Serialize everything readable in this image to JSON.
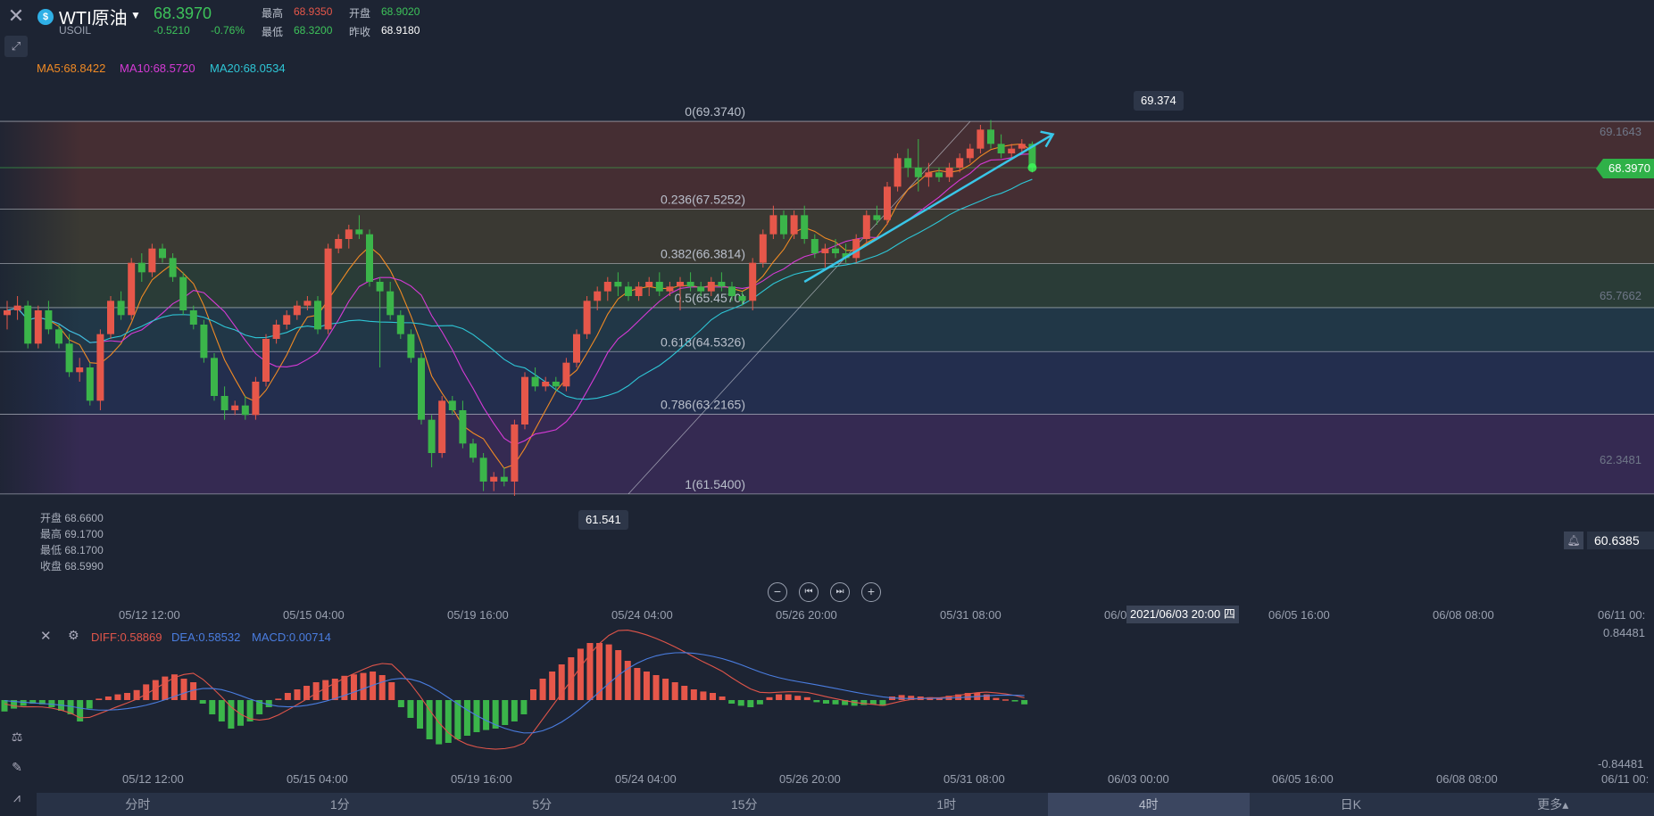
{
  "header": {
    "symbol_name": "WTI原油",
    "symbol_code": "USOIL",
    "last_price": "68.3970",
    "change": "-0.5210",
    "change_pct": "-0.76%",
    "quote_labels": {
      "high": "最高",
      "low": "最低",
      "open": "开盘",
      "prev_close": "昨收"
    },
    "quote_values": {
      "high": "68.9350",
      "low": "68.3200",
      "open": "68.9020",
      "prev_close": "68.9180"
    }
  },
  "ma_legend": [
    {
      "label": "MA5:68.8422",
      "color": "#f08a24"
    },
    {
      "label": "MA10:68.5720",
      "color": "#d63ad6"
    },
    {
      "label": "MA20:68.0534",
      "color": "#2ec6d6"
    }
  ],
  "fib_levels": [
    {
      "ratio": 0,
      "label": "0(69.3740)",
      "price": 69.374
    },
    {
      "ratio": 0.236,
      "label": "0.236(67.5252)",
      "price": 67.5252
    },
    {
      "ratio": 0.382,
      "label": "0.382(66.3814)",
      "price": 66.3814
    },
    {
      "ratio": 0.5,
      "label": "0.5(65.4570)",
      "price": 65.457
    },
    {
      "ratio": 0.618,
      "label": "0.618(64.5326)",
      "price": 64.5326
    },
    {
      "ratio": 0.786,
      "label": "0.786(63.2165)",
      "price": 63.2165
    },
    {
      "ratio": 1,
      "label": "1(61.5400)",
      "price": 61.54
    }
  ],
  "price_axis": [
    "69.1643",
    "65.7662",
    "62.3481"
  ],
  "current_price_tag": "68.3970",
  "high_marker": "69.374",
  "low_marker": "61.541",
  "alert_price": "60.6385",
  "ohlc": [
    {
      "label": "开盘",
      "value": "68.6600"
    },
    {
      "label": "最高",
      "value": "69.1700"
    },
    {
      "label": "最低",
      "value": "68.1700"
    },
    {
      "label": "收盘",
      "value": "68.5990"
    }
  ],
  "x_axis_main": [
    "05/12 12:00",
    "05/15 04:00",
    "05/19 16:00",
    "05/24 04:00",
    "05/26 20:00",
    "05/31 08:00",
    "06/0",
    "06/05 16:00",
    "06/08 08:00",
    "06/11 00:"
  ],
  "crosshair_time": "2021/06/03 20:00 四",
  "x_axis_macd": [
    "05/12 12:00",
    "05/15 04:00",
    "05/19 16:00",
    "05/24 04:00",
    "05/26 20:00",
    "05/31 08:00",
    "06/03 00:00",
    "06/05 16:00",
    "06/08 08:00",
    "06/11 00:"
  ],
  "macd_legend": [
    {
      "label": "DIFF:0.58869",
      "color": "#e0554a"
    },
    {
      "label": "DEA:0.58532",
      "color": "#4a7de0"
    },
    {
      "label": "MACD:0.00714",
      "color": "#4a7de0"
    }
  ],
  "macd_axis": [
    "0.84481",
    "-0.84481"
  ],
  "timeframes": [
    {
      "label": "分时",
      "active": false
    },
    {
      "label": "1分",
      "active": false
    },
    {
      "label": "5分",
      "active": false
    },
    {
      "label": "15分",
      "active": false
    },
    {
      "label": "1时",
      "active": false
    },
    {
      "label": "4时",
      "active": true
    },
    {
      "label": "日K",
      "active": false
    },
    {
      "label": "更多▴",
      "active": false
    }
  ],
  "colors": {
    "up": "#e6574a",
    "down": "#3bb54a",
    "background": "#1d2433"
  },
  "icons": [
    "close-icon",
    "expand-icon",
    "symbol-icon",
    "zoom-out-icon",
    "step-back-icon",
    "step-forward-icon",
    "zoom-in-icon",
    "bell-icon",
    "indicator-icon",
    "pen-icon",
    "chart-type-icon",
    "settings-icon"
  ],
  "chart_data": {
    "type": "candlestick",
    "ylim": [
      60.3,
      70.8
    ],
    "candles": [
      [
        65.3,
        65.6,
        65.0,
        65.4
      ],
      [
        65.4,
        65.7,
        65.2,
        65.5
      ],
      [
        65.5,
        65.6,
        64.6,
        64.7
      ],
      [
        64.7,
        65.5,
        64.6,
        65.4
      ],
      [
        65.4,
        65.6,
        64.9,
        65.0
      ],
      [
        65.0,
        65.1,
        64.6,
        64.7
      ],
      [
        64.7,
        64.9,
        64.0,
        64.1
      ],
      [
        64.1,
        64.4,
        63.9,
        64.2
      ],
      [
        64.2,
        64.3,
        63.4,
        63.5
      ],
      [
        63.5,
        65.0,
        63.3,
        64.9
      ],
      [
        64.9,
        65.7,
        64.8,
        65.6
      ],
      [
        65.6,
        65.8,
        65.2,
        65.3
      ],
      [
        65.3,
        66.5,
        65.2,
        66.4
      ],
      [
        66.4,
        66.6,
        66.0,
        66.2
      ],
      [
        66.2,
        66.8,
        66.1,
        66.7
      ],
      [
        66.7,
        66.8,
        66.4,
        66.5
      ],
      [
        66.5,
        66.6,
        66.0,
        66.1
      ],
      [
        66.1,
        66.2,
        65.3,
        65.4
      ],
      [
        65.4,
        65.5,
        65.0,
        65.1
      ],
      [
        65.1,
        65.2,
        64.3,
        64.4
      ],
      [
        64.4,
        64.5,
        63.5,
        63.6
      ],
      [
        63.6,
        63.8,
        63.1,
        63.3
      ],
      [
        63.3,
        63.5,
        63.2,
        63.4
      ],
      [
        63.4,
        63.6,
        63.1,
        63.2
      ],
      [
        63.2,
        64.0,
        63.1,
        63.9
      ],
      [
        63.9,
        64.9,
        63.8,
        64.8
      ],
      [
        64.8,
        65.2,
        64.7,
        65.1
      ],
      [
        65.1,
        65.4,
        65.0,
        65.3
      ],
      [
        65.3,
        65.6,
        65.2,
        65.5
      ],
      [
        65.5,
        65.7,
        65.4,
        65.6
      ],
      [
        65.6,
        65.7,
        64.9,
        65.0
      ],
      [
        65.0,
        66.8,
        64.9,
        66.7
      ],
      [
        66.7,
        67.0,
        66.6,
        66.9
      ],
      [
        66.9,
        67.2,
        66.7,
        67.1
      ],
      [
        67.1,
        67.4,
        66.9,
        67.0
      ],
      [
        67.0,
        67.1,
        65.9,
        66.0
      ],
      [
        66.0,
        66.1,
        64.2,
        65.8
      ],
      [
        65.8,
        66.0,
        65.2,
        65.3
      ],
      [
        65.3,
        65.4,
        64.8,
        64.9
      ],
      [
        64.9,
        65.0,
        64.3,
        64.4
      ],
      [
        64.4,
        64.5,
        63.0,
        63.1
      ],
      [
        63.1,
        63.2,
        62.1,
        62.4
      ],
      [
        62.4,
        63.6,
        62.3,
        63.5
      ],
      [
        63.5,
        63.6,
        63.2,
        63.3
      ],
      [
        63.3,
        63.5,
        62.5,
        62.6
      ],
      [
        62.6,
        62.7,
        62.2,
        62.3
      ],
      [
        62.3,
        62.4,
        61.6,
        61.8
      ],
      [
        61.8,
        62.0,
        61.6,
        61.9
      ],
      [
        61.9,
        62.1,
        61.7,
        61.8
      ],
      [
        61.8,
        63.1,
        61.5,
        63.0
      ],
      [
        63.0,
        64.1,
        62.9,
        64.0
      ],
      [
        64.0,
        64.2,
        63.7,
        63.8
      ],
      [
        63.8,
        64.0,
        63.7,
        63.9
      ],
      [
        63.9,
        64.0,
        63.7,
        63.8
      ],
      [
        63.8,
        64.4,
        63.7,
        64.3
      ],
      [
        64.3,
        65.0,
        64.2,
        64.9
      ],
      [
        64.9,
        65.7,
        64.8,
        65.6
      ],
      [
        65.6,
        65.9,
        65.4,
        65.8
      ],
      [
        65.8,
        66.1,
        65.6,
        66.0
      ],
      [
        66.0,
        66.2,
        65.7,
        65.9
      ],
      [
        65.9,
        66.0,
        65.6,
        65.7
      ],
      [
        65.7,
        66.0,
        65.6,
        65.9
      ],
      [
        65.9,
        66.1,
        65.7,
        66.0
      ],
      [
        66.0,
        66.2,
        65.7,
        65.8
      ],
      [
        65.8,
        66.0,
        65.7,
        65.9
      ],
      [
        65.9,
        66.1,
        65.4,
        66.0
      ],
      [
        66.0,
        66.2,
        65.8,
        65.9
      ],
      [
        65.9,
        66.0,
        65.7,
        65.8
      ],
      [
        65.8,
        66.1,
        65.7,
        66.0
      ],
      [
        66.0,
        66.2,
        65.8,
        65.9
      ],
      [
        65.9,
        66.0,
        65.6,
        65.7
      ],
      [
        65.7,
        65.8,
        65.5,
        65.6
      ],
      [
        65.6,
        66.5,
        65.4,
        66.4
      ],
      [
        66.4,
        67.1,
        66.3,
        67.0
      ],
      [
        67.0,
        67.6,
        66.9,
        67.4
      ],
      [
        67.4,
        67.5,
        66.9,
        67.0
      ],
      [
        67.0,
        67.5,
        66.9,
        67.4
      ],
      [
        67.4,
        67.6,
        66.8,
        66.9
      ],
      [
        66.9,
        67.0,
        66.5,
        66.6
      ],
      [
        66.6,
        66.8,
        66.3,
        66.7
      ],
      [
        66.7,
        66.9,
        66.5,
        66.6
      ],
      [
        66.6,
        66.8,
        66.4,
        66.5
      ],
      [
        66.5,
        67.0,
        66.4,
        66.9
      ],
      [
        66.9,
        67.5,
        66.8,
        67.4
      ],
      [
        67.4,
        67.6,
        67.2,
        67.3
      ],
      [
        67.3,
        68.1,
        67.2,
        68.0
      ],
      [
        68.0,
        68.7,
        67.9,
        68.6
      ],
      [
        68.6,
        68.8,
        68.2,
        68.4
      ],
      [
        68.4,
        69.0,
        67.9,
        68.2
      ],
      [
        68.2,
        68.5,
        68.0,
        68.3
      ],
      [
        68.3,
        68.4,
        68.1,
        68.2
      ],
      [
        68.2,
        68.5,
        68.1,
        68.4
      ],
      [
        68.4,
        68.7,
        68.3,
        68.6
      ],
      [
        68.6,
        68.9,
        68.5,
        68.8
      ],
      [
        68.8,
        69.3,
        68.7,
        69.2
      ],
      [
        69.2,
        69.4,
        68.8,
        68.9
      ],
      [
        68.9,
        69.1,
        68.6,
        68.7
      ],
      [
        68.7,
        68.9,
        68.6,
        68.8
      ],
      [
        68.8,
        69.0,
        68.7,
        68.9
      ],
      [
        68.9,
        68.95,
        68.3,
        68.4
      ]
    ],
    "macd_hist": [
      -0.16,
      -0.12,
      -0.08,
      -0.05,
      -0.06,
      -0.1,
      -0.15,
      -0.2,
      -0.3,
      -0.12,
      0.02,
      0.05,
      0.08,
      0.1,
      0.14,
      0.22,
      0.28,
      0.33,
      0.36,
      0.3,
      0.25,
      -0.05,
      -0.2,
      -0.3,
      -0.4,
      -0.36,
      -0.3,
      -0.2,
      -0.1,
      0.02,
      0.1,
      0.15,
      0.2,
      0.25,
      0.28,
      0.3,
      0.34,
      0.36,
      0.38,
      0.4,
      0.35,
      0.25,
      -0.1,
      -0.25,
      -0.4,
      -0.55,
      -0.62,
      -0.6,
      -0.55,
      -0.5,
      -0.45,
      -0.42,
      -0.4,
      -0.35,
      -0.3,
      -0.2,
      0.15,
      0.3,
      0.4,
      0.5,
      0.6,
      0.72,
      0.8,
      0.8,
      0.78,
      0.7,
      0.55,
      0.45,
      0.4,
      0.35,
      0.3,
      0.25,
      0.2,
      0.15,
      0.12,
      0.1,
      0.05,
      -0.05,
      -0.08,
      -0.1,
      -0.06,
      0.04,
      0.08,
      0.08,
      0.06,
      0.04,
      -0.03,
      -0.05,
      -0.06,
      -0.07,
      -0.08,
      -0.07,
      -0.06,
      -0.08,
      0.05,
      0.07,
      0.06,
      0.05,
      0.04,
      0.02,
      0.06,
      0.08,
      0.1,
      0.1,
      0.08,
      0.03,
      0.01,
      -0.02,
      -0.06
    ]
  }
}
